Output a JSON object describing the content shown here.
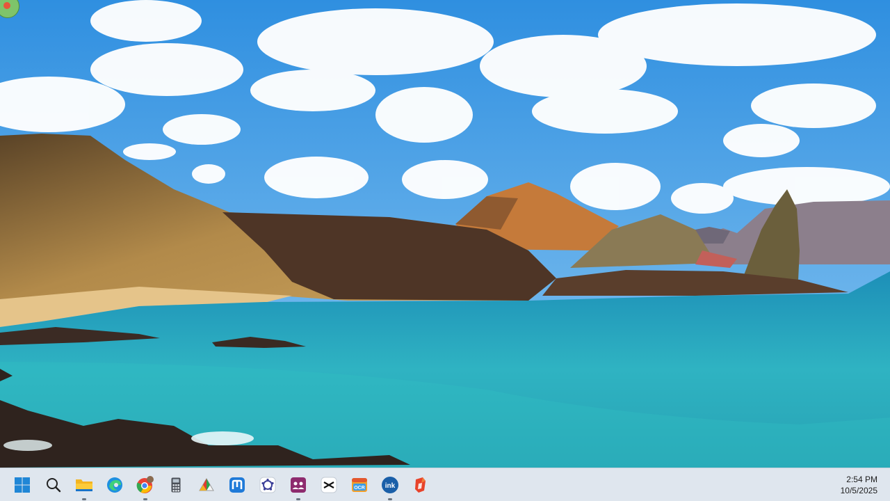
{
  "taskbar": {
    "icons": [
      {
        "name": "start-icon"
      },
      {
        "name": "search-icon"
      },
      {
        "name": "file-explorer-icon"
      },
      {
        "name": "edge-icon"
      },
      {
        "name": "chrome-icon"
      },
      {
        "name": "calculator-icon"
      },
      {
        "name": "paint-app-icon"
      },
      {
        "name": "app-m-icon"
      },
      {
        "name": "app-gear-icon"
      },
      {
        "name": "meeting-app-icon"
      },
      {
        "name": "capcut-icon"
      },
      {
        "name": "ocr-app-icon"
      },
      {
        "name": "ink-app-icon"
      },
      {
        "name": "office-app-icon"
      }
    ],
    "ink_label": "ink",
    "ocr_label": "OCR",
    "clock": {
      "time": "2:54 PM",
      "date": "10/5/2025"
    }
  }
}
